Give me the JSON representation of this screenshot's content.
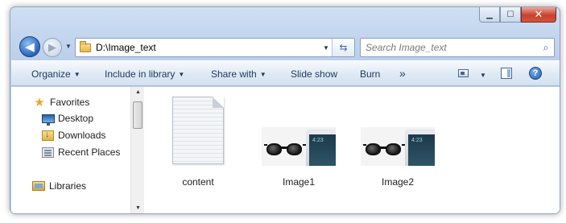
{
  "window": {
    "caption_buttons": {
      "minimize": "▁",
      "maximize": "☐",
      "close": "✕"
    }
  },
  "navigation": {
    "back_glyph": "◀",
    "forward_glyph": "▶",
    "recent_glyph": "▼",
    "address": "D:\\Image_text",
    "address_dropdown_glyph": "▼",
    "refresh_glyph": "⇆",
    "search_placeholder": "Search Image_text",
    "search_glyph": "⌕"
  },
  "toolbar": {
    "organize": "Organize",
    "include_in_library": "Include in library",
    "share_with": "Share with",
    "slide_show": "Slide show",
    "burn": "Burn",
    "more": "»",
    "dropdown_glyph": "▼",
    "help_glyph": "?"
  },
  "nav_pane": {
    "favorites": "Favorites",
    "desktop": "Desktop",
    "downloads": "Downloads",
    "recent_places": "Recent Places",
    "libraries": "Libraries",
    "star_glyph": "★",
    "scroll_up_glyph": "▲",
    "scroll_down_glyph": "▼"
  },
  "files": [
    {
      "name": "content"
    },
    {
      "name": "Image1",
      "thumb_text": "4:23"
    },
    {
      "name": "Image2",
      "thumb_text": "4:23"
    }
  ]
}
